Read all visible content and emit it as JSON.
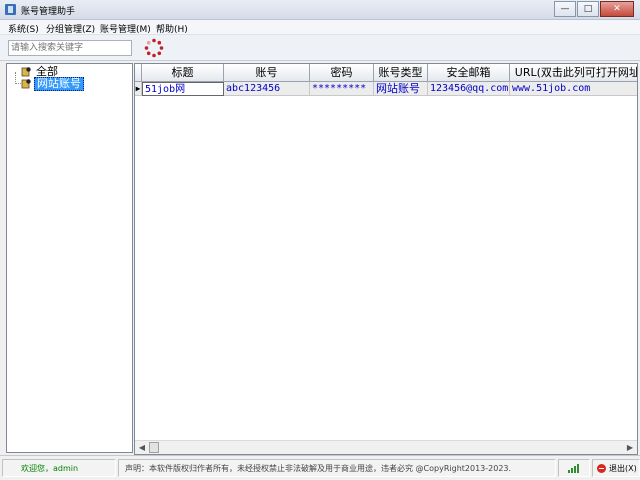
{
  "window": {
    "title": "账号管理助手",
    "minimize_label": "—",
    "maximize_label": "□",
    "close_label": "✕"
  },
  "menu": [
    {
      "label": "系统(S)"
    },
    {
      "label": "分组管理(Z)"
    },
    {
      "label": "账号管理(M)"
    },
    {
      "label": "帮助(H)"
    }
  ],
  "toolbar": {
    "search_placeholder": "请输入搜索关键字"
  },
  "tree": {
    "root_label": "全部",
    "child_label": "网站账号"
  },
  "grid": {
    "columns": [
      "标题",
      "账号",
      "密码",
      "账号类型",
      "安全邮箱",
      "URL(双击此列可打开网址)"
    ],
    "rows": [
      {
        "indicator": "▶",
        "title": "51job网",
        "account": "abc123456",
        "password": "*********",
        "type": "网站账号",
        "email": "123456@qq.com",
        "url": "www.51job.com"
      }
    ]
  },
  "statusbar": {
    "user": "欢迎您，admin",
    "notice": "声明：本软件版权归作者所有，未经授权禁止非法破解及用于商业用途，违者必究  @CopyRight2013-2023.",
    "exit_label": "退出(X)"
  },
  "colors": {
    "selection": "#3399ff",
    "link_text": "#0000c8",
    "user_text": "#008000",
    "exit": "#d6281f"
  }
}
